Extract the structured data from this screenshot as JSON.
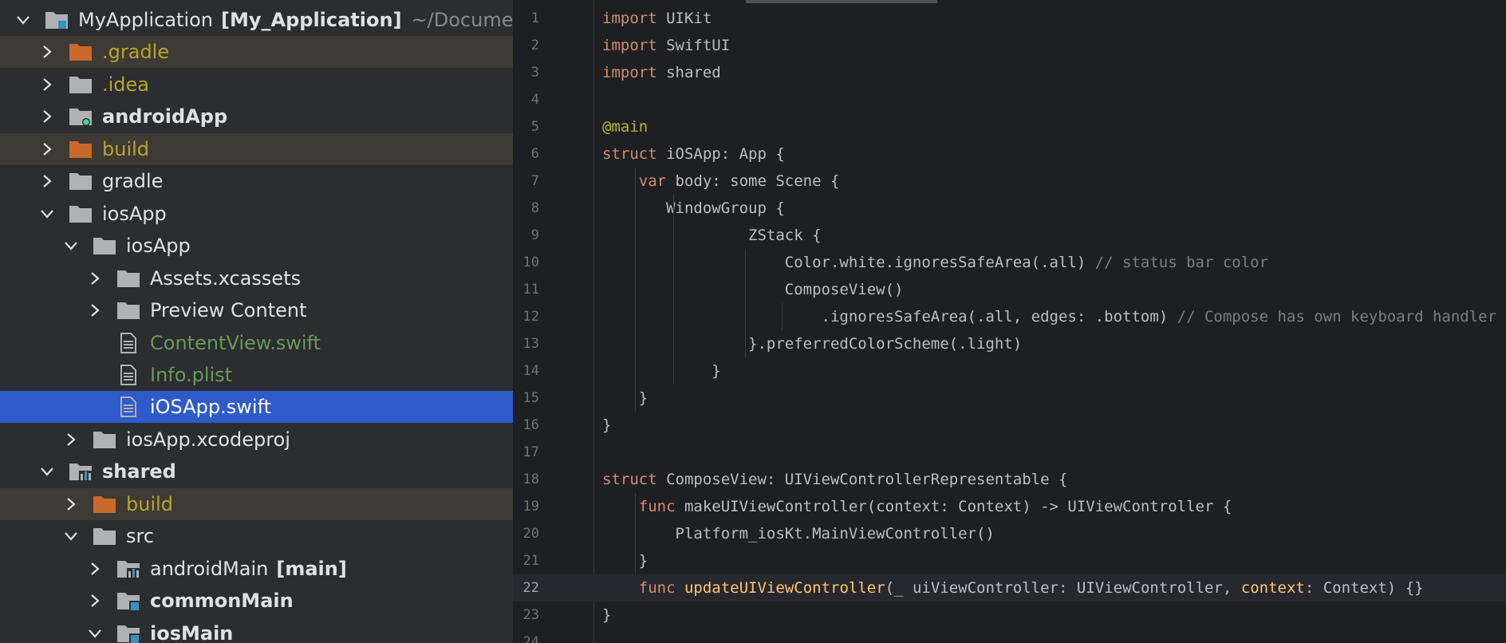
{
  "project_tree": [
    {
      "label": "MyApplication",
      "extra": "[My_Application]",
      "path": "~/Documents",
      "depth": 0,
      "expanded": true,
      "icon": "module-folder-icon",
      "style": "normal"
    },
    {
      "label": ".gradle",
      "depth": 1,
      "expanded": false,
      "icon": "excluded-folder-icon",
      "style": "excluded"
    },
    {
      "label": ".idea",
      "depth": 1,
      "expanded": false,
      "icon": "folder-icon",
      "style": "excluded-text"
    },
    {
      "label": "androidApp",
      "depth": 1,
      "expanded": false,
      "icon": "android-module-icon",
      "style": "bold"
    },
    {
      "label": "build",
      "depth": 1,
      "expanded": false,
      "icon": "excluded-folder-icon",
      "style": "excluded"
    },
    {
      "label": "gradle",
      "depth": 1,
      "expanded": false,
      "icon": "folder-icon",
      "style": "normal"
    },
    {
      "label": "iosApp",
      "depth": 1,
      "expanded": true,
      "icon": "folder-icon",
      "style": "normal"
    },
    {
      "label": "iosApp",
      "depth": 2,
      "expanded": true,
      "icon": "folder-icon",
      "style": "normal"
    },
    {
      "label": "Assets.xcassets",
      "depth": 3,
      "expanded": false,
      "icon": "folder-icon",
      "style": "normal"
    },
    {
      "label": "Preview Content",
      "depth": 3,
      "expanded": false,
      "icon": "folder-icon",
      "style": "normal"
    },
    {
      "label": "ContentView.swift",
      "depth": 3,
      "leaf": true,
      "icon": "file-icon",
      "style": "git"
    },
    {
      "label": "Info.plist",
      "depth": 3,
      "leaf": true,
      "icon": "file-icon",
      "style": "git"
    },
    {
      "label": "iOSApp.swift",
      "depth": 3,
      "leaf": true,
      "icon": "file-icon",
      "style": "selected"
    },
    {
      "label": "iosApp.xcodeproj",
      "depth": 2,
      "expanded": false,
      "icon": "folder-icon",
      "style": "normal"
    },
    {
      "label": "shared",
      "depth": 1,
      "expanded": true,
      "icon": "library-module-icon",
      "style": "bold"
    },
    {
      "label": "build",
      "depth": 2,
      "expanded": false,
      "icon": "excluded-folder-icon",
      "style": "excluded"
    },
    {
      "label": "src",
      "depth": 2,
      "expanded": true,
      "icon": "folder-icon",
      "style": "normal"
    },
    {
      "label": "androidMain",
      "extra": "[main]",
      "depth": 3,
      "expanded": false,
      "icon": "library-module-icon",
      "style": "normal"
    },
    {
      "label": "commonMain",
      "depth": 3,
      "expanded": false,
      "icon": "source-set-icon",
      "style": "bold"
    },
    {
      "label": "iosMain",
      "depth": 3,
      "expanded": true,
      "icon": "source-set-icon",
      "style": "bold"
    }
  ],
  "editor": {
    "current_line": 22,
    "lines": [
      [
        [
          "kw",
          "import"
        ],
        [
          "p",
          " UIKit"
        ]
      ],
      [
        [
          "kw",
          "import"
        ],
        [
          "p",
          " SwiftUI"
        ]
      ],
      [
        [
          "kw",
          "import"
        ],
        [
          "p",
          " shared"
        ]
      ],
      [],
      [
        [
          "ann",
          "@main"
        ]
      ],
      [
        [
          "kw",
          "struct"
        ],
        [
          "p",
          " iOSApp: App {"
        ]
      ],
      [
        [
          "p",
          "    "
        ],
        [
          "kw",
          "var"
        ],
        [
          "p",
          " body: some Scene {"
        ]
      ],
      [
        [
          "p",
          "       WindowGroup {"
        ]
      ],
      [
        [
          "p",
          "                ZStack {"
        ]
      ],
      [
        [
          "p",
          "                    Color.white.ignoresSafeArea(.all) "
        ],
        [
          "cm",
          "// status bar color"
        ]
      ],
      [
        [
          "p",
          "                    ComposeView()"
        ]
      ],
      [
        [
          "p",
          "                        .ignoresSafeArea(.all, edges: .bottom) "
        ],
        [
          "cm",
          "// Compose has own keyboard handler"
        ]
      ],
      [
        [
          "p",
          "                }.preferredColorScheme(.light)"
        ]
      ],
      [
        [
          "p",
          "            }"
        ]
      ],
      [
        [
          "p",
          "    }"
        ]
      ],
      [
        [
          "p",
          "}"
        ]
      ],
      [],
      [
        [
          "kw",
          "struct"
        ],
        [
          "p",
          " ComposeView: UIViewControllerRepresentable {"
        ]
      ],
      [
        [
          "p",
          "    "
        ],
        [
          "kw",
          "func"
        ],
        [
          "p",
          " makeUIViewController(context: Context) -> UIViewController {"
        ]
      ],
      [
        [
          "p",
          "        Platform_iosKt.MainViewController()"
        ]
      ],
      [
        [
          "p",
          "    }"
        ]
      ],
      [
        [
          "p",
          "    "
        ],
        [
          "kw",
          "func"
        ],
        [
          "p",
          " "
        ],
        [
          "fnu",
          "updateUIViewController"
        ],
        [
          "p",
          "(_ uiViewController: UIViewController, "
        ],
        [
          "param",
          "context"
        ],
        [
          "p",
          ": Context) {}"
        ]
      ],
      [
        [
          "p",
          "}"
        ]
      ],
      []
    ]
  }
}
